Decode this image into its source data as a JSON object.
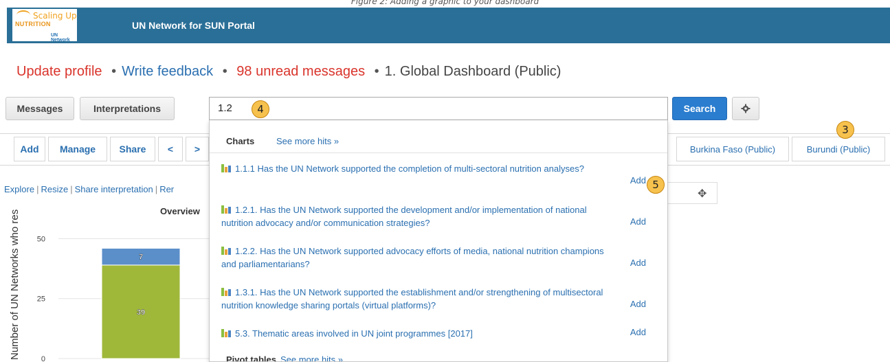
{
  "caption": "Figure 2: Adding a graphic to your dashboard",
  "header": {
    "logo": {
      "line1": "Scaling Up",
      "line2": "NUTRITION",
      "line3": "UN Network"
    },
    "title": "UN Network for SUN Portal",
    "colors": {
      "bar": "#2a6f97"
    }
  },
  "top_links": {
    "update_profile": "Update profile",
    "write_feedback": "Write feedback",
    "unread_messages": "98 unread messages",
    "dashboard": "1. Global Dashboard (Public)",
    "bullet": "•"
  },
  "controls": {
    "messages": "Messages",
    "interpretations": "Interpretations",
    "search_value": "1.2",
    "search_button": "Search",
    "settings_icon": "gear-icon"
  },
  "toolbar": {
    "add": "Add",
    "manage": "Manage",
    "share": "Share",
    "prev": "<",
    "next": ">",
    "tabs": [
      "Burkina Faso (Public)",
      "Burundi (Public)"
    ]
  },
  "widget": {
    "links": [
      "Explore",
      "Resize",
      "Share interpretation",
      "Rer"
    ],
    "link_sep": "|",
    "title": "Overview",
    "move_icon": "move-icon"
  },
  "chart_data": {
    "type": "bar",
    "title": "Overview",
    "ylabel": "Number of UN Networks who res",
    "ylim": [
      0,
      55
    ],
    "yticks": [
      0,
      25,
      50
    ],
    "series": [
      {
        "values": [
          39
        ],
        "color": "#9fb83a"
      },
      {
        "values": [
          7
        ],
        "color": "#5b8fc9"
      }
    ],
    "categories": [
      ""
    ]
  },
  "dropdown": {
    "charts_header": "Charts",
    "see_more": "See more hits »",
    "add_label": "Add",
    "items": [
      {
        "text": "1.1.1 Has the UN Network supported the completion of multi-sectoral nutrition analyses?"
      },
      {
        "text": "1.2.1. Has the UN Network supported the development and/or implementation of national nutrition advocacy and/or communication strategies?"
      },
      {
        "text": "1.2.2. Has the UN Network supported advocacy efforts of media, national nutrition champions and parliamentarians?"
      },
      {
        "text": "1.3.1. Has the UN Network supported the establishment and/or strengthening of multisectoral nutrition knowledge sharing portals (virtual platforms)?"
      },
      {
        "text": "5.3. Thematic areas involved in UN joint programmes [2017]"
      }
    ],
    "pivot_header": "Pivot tables"
  },
  "markers": {
    "m3": "3",
    "m4": "4",
    "m5": "5"
  }
}
